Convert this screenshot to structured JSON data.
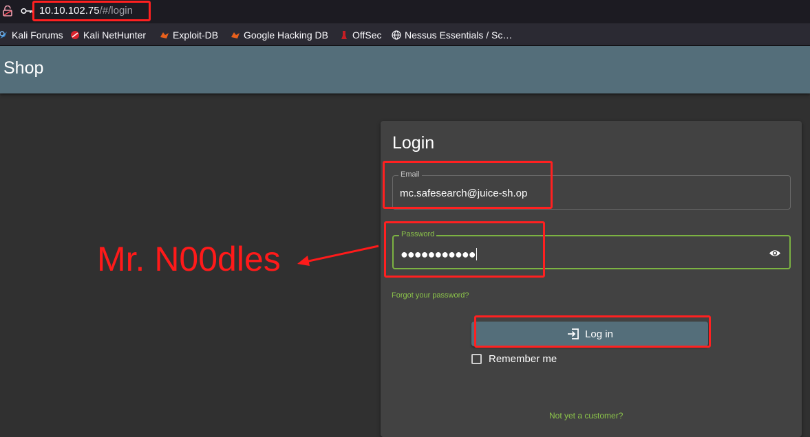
{
  "browser": {
    "url_host": "10.10.102.75",
    "url_path": "/#/login",
    "bookmarks": [
      {
        "label": "Kali Forums",
        "icon": "kali-forums-icon"
      },
      {
        "label": "Kali NetHunter",
        "icon": "kali-nethunter-icon"
      },
      {
        "label": "Exploit-DB",
        "icon": "exploit-db-icon"
      },
      {
        "label": "Google Hacking DB",
        "icon": "ghdb-icon"
      },
      {
        "label": "OffSec",
        "icon": "offsec-icon"
      },
      {
        "label": "Nessus Essentials / Sc…",
        "icon": "globe-icon"
      }
    ]
  },
  "app": {
    "title": "Shop"
  },
  "login": {
    "title": "Login",
    "email_label": "Email",
    "email_value": "mc.safesearch@juice-sh.op",
    "password_label": "Password",
    "password_value": "●●●●●●●●●●●",
    "forgot_label": "Forgot your password?",
    "login_button": "Log in",
    "remember_label": "Remember me",
    "remember_checked": false,
    "register_label": "Not yet a customer?"
  },
  "annotation": {
    "text": "Mr. N00dles",
    "color": "#ff1a1a"
  },
  "colors": {
    "toolbar": "#546e7a",
    "accent": "#8bc34a",
    "card": "#424242",
    "background": "#303030"
  }
}
